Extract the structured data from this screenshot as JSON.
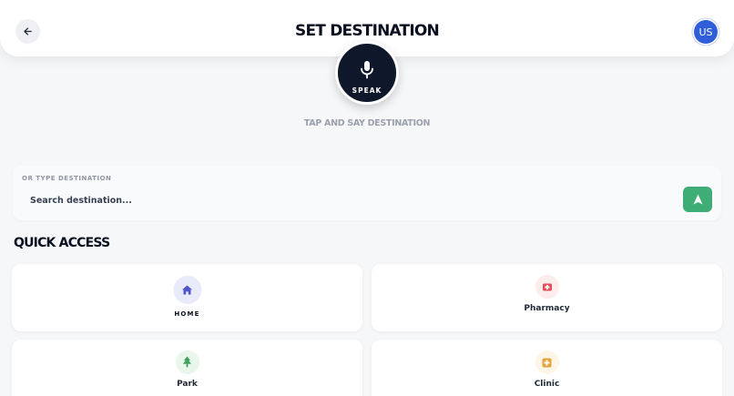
{
  "header": {
    "title": "SET DESTINATION",
    "back_icon": "arrow-left-icon",
    "avatar_initials": "US",
    "avatar_color": "#2f5ed8"
  },
  "voice": {
    "button_label": "SPEAK",
    "icon": "microphone-icon",
    "hint": "TAP AND SAY DESTINATION"
  },
  "search": {
    "caption": "OR TYPE DESTINATION",
    "placeholder": "Search destination...",
    "value": "",
    "go_icon": "navigate-arrow-icon",
    "go_color": "#3fae76"
  },
  "quick_access": {
    "title": "QUICK ACCESS",
    "items": [
      {
        "label": "HOME",
        "icon": "home-icon",
        "color": "#4f56c9"
      },
      {
        "label": "Pharmacy",
        "icon": "pharmacy-icon",
        "color": "#e0505a"
      },
      {
        "label": "Park",
        "icon": "tree-icon",
        "color": "#3fa05c"
      },
      {
        "label": "Clinic",
        "icon": "medical-cross-icon",
        "color": "#e6a23a"
      }
    ]
  }
}
